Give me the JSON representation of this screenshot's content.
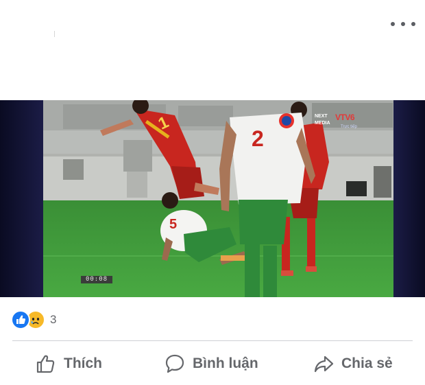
{
  "post": {
    "more_icon": "more-horizontal-icon"
  },
  "video": {
    "timecode": "00:08",
    "broadcaster_brand": "NEXT MEDIA",
    "broadcaster_channel": "VTV6",
    "broadcaster_status": "Trực tiếp",
    "player_numbers": {
      "red_falling": "1",
      "white_defender": "2",
      "white_sliding": "5"
    }
  },
  "reactions": {
    "icons": [
      "like-icon",
      "sad-icon"
    ],
    "count": "3"
  },
  "actions": {
    "like_label": "Thích",
    "comment_label": "Bình luận",
    "share_label": "Chia sẻ"
  },
  "colors": {
    "like_blue": "#1877f2",
    "sad_yellow": "#f7b928",
    "action_text": "#65676b",
    "pitch_green": "#3f9c3a"
  }
}
